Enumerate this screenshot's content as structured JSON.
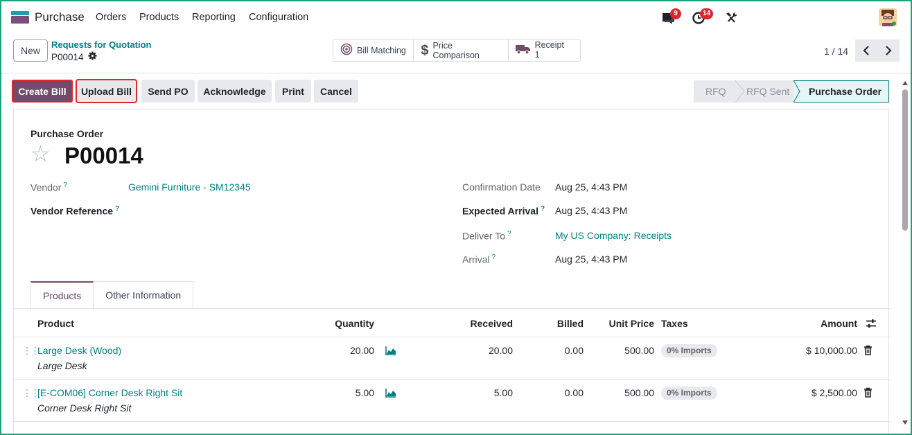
{
  "app": {
    "name": "Purchase",
    "menu": [
      "Orders",
      "Products",
      "Reporting",
      "Configuration"
    ],
    "messages_count": "9",
    "activities_count": "14"
  },
  "control": {
    "new_label": "New",
    "breadcrumb": "Requests for Quotation",
    "record": "P00014",
    "smart_buttons": {
      "bill_matching": "Bill Matching",
      "price_comparison": "Price Comparison",
      "receipt_label": "Receipt",
      "receipt_count": "1"
    },
    "pager": "1 / 14"
  },
  "actions": {
    "create_bill": "Create Bill",
    "upload_bill": "Upload Bill",
    "send_po": "Send PO",
    "acknowledge": "Acknowledge",
    "print": "Print",
    "cancel": "Cancel"
  },
  "stages": [
    "RFQ",
    "RFQ Sent",
    "Purchase Order"
  ],
  "form": {
    "subtitle": "Purchase Order",
    "title": "P00014",
    "vendor_label": "Vendor",
    "vendor": "Gemini Furniture - SM12345",
    "vendor_ref_label": "Vendor Reference",
    "confirmation_label": "Confirmation Date",
    "confirmation": "Aug 25, 4:43 PM",
    "expected_label": "Expected Arrival",
    "expected": "Aug 25, 4:43 PM",
    "deliver_label": "Deliver To",
    "deliver": "My US Company: Receipts",
    "arrival_label": "Arrival",
    "arrival": "Aug 25, 4:43 PM",
    "help_mark": "?"
  },
  "tabs": [
    "Products",
    "Other Information"
  ],
  "table": {
    "headers": {
      "product": "Product",
      "quantity": "Quantity",
      "received": "Received",
      "billed": "Billed",
      "unit_price": "Unit Price",
      "taxes": "Taxes",
      "amount": "Amount"
    },
    "rows": [
      {
        "product": "Large Desk (Wood)",
        "description": "Large Desk",
        "quantity": "20.00",
        "received": "20.00",
        "billed": "0.00",
        "unit_price": "500.00",
        "tax": "0% Imports",
        "amount": "$ 10,000.00"
      },
      {
        "product": "[E-COM06] Corner Desk Right Sit",
        "description": "Corner Desk Right Sit",
        "quantity": "5.00",
        "received": "5.00",
        "billed": "0.00",
        "unit_price": "500.00",
        "tax": "0% Imports",
        "amount": "$ 2,500.00"
      }
    ]
  },
  "icons": {
    "messages": "chat-icon",
    "activities": "clock-icon",
    "debug": "tools-icon",
    "settings": "gear-icon",
    "forecast": "area-chart-icon",
    "delete": "trash-icon",
    "optional_columns": "sliders-icon"
  },
  "colors": {
    "brand": "#714b67",
    "link": "#017e84",
    "badge": "#d9292f",
    "highlight": "#d9292f"
  }
}
